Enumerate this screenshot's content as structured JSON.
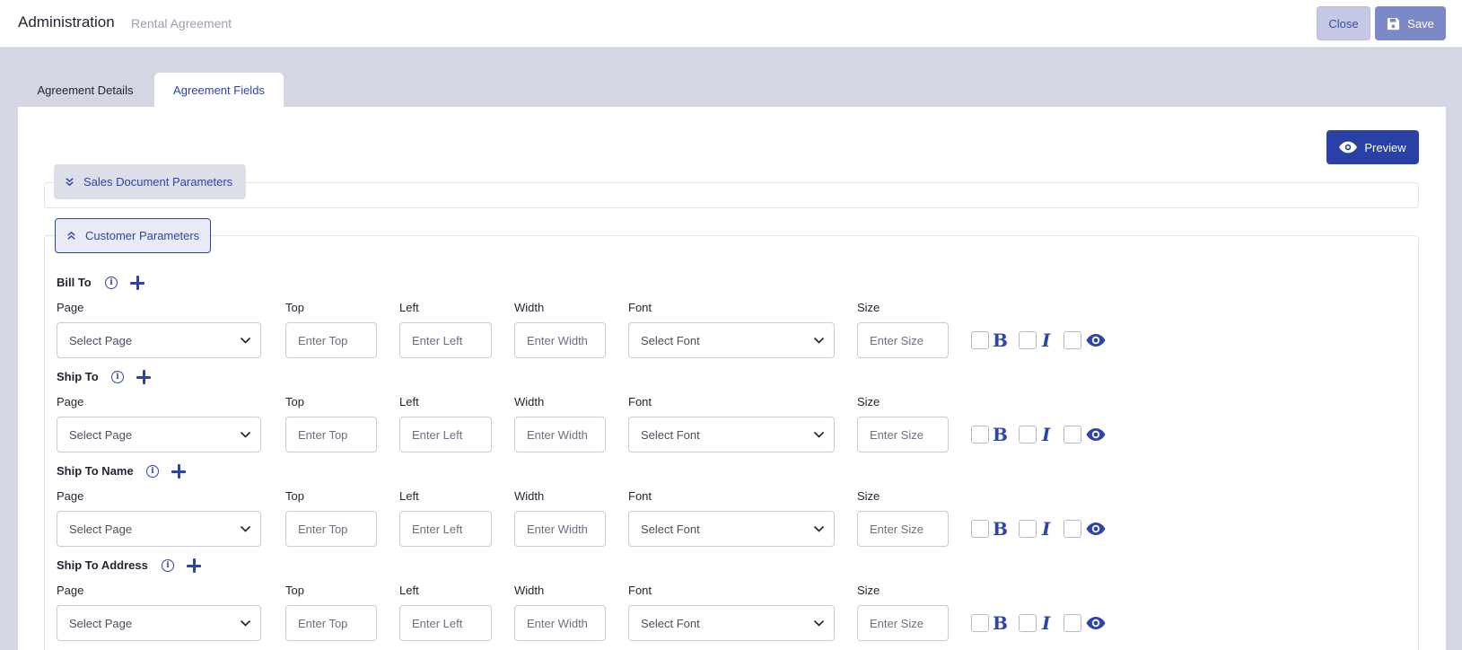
{
  "header": {
    "title": "Administration",
    "subtitle": "Rental Agreement",
    "close_label": "Close",
    "save_label": "Save"
  },
  "tabs": [
    {
      "label": "Agreement Details",
      "active": false
    },
    {
      "label": "Agreement Fields",
      "active": true
    }
  ],
  "preview_label": "Preview",
  "sections": {
    "sales": {
      "label": "Sales Document Parameters",
      "expanded": false
    },
    "customer": {
      "label": "Customer Parameters",
      "expanded": true
    }
  },
  "columns": {
    "page_label": "Page",
    "top_label": "Top",
    "left_label": "Left",
    "width_label": "Width",
    "font_label": "Font",
    "size_label": "Size"
  },
  "placeholders": {
    "page": "Select Page",
    "top": "Enter Top",
    "left": "Enter Left",
    "width": "Enter Width",
    "font": "Select Font",
    "size": "Enter Size"
  },
  "fields": [
    {
      "label": "Bill To"
    },
    {
      "label": "Ship To"
    },
    {
      "label": "Ship To Name"
    },
    {
      "label": "Ship To Address"
    }
  ],
  "colors": {
    "accent": "#2e45a8",
    "preview_bg": "#2940a6",
    "save_bg": "#7d88c7",
    "page_bg": "#d5d6e3"
  },
  "icons": {
    "save": "floppy-disk-icon",
    "preview": "eye-icon",
    "collapse": "chevron-double-up-icon",
    "expand": "chevron-double-down-icon",
    "info": "info-icon",
    "add": "plus-icon",
    "bold": "bold-icon",
    "italic": "italic-icon",
    "visible": "eye-icon"
  }
}
